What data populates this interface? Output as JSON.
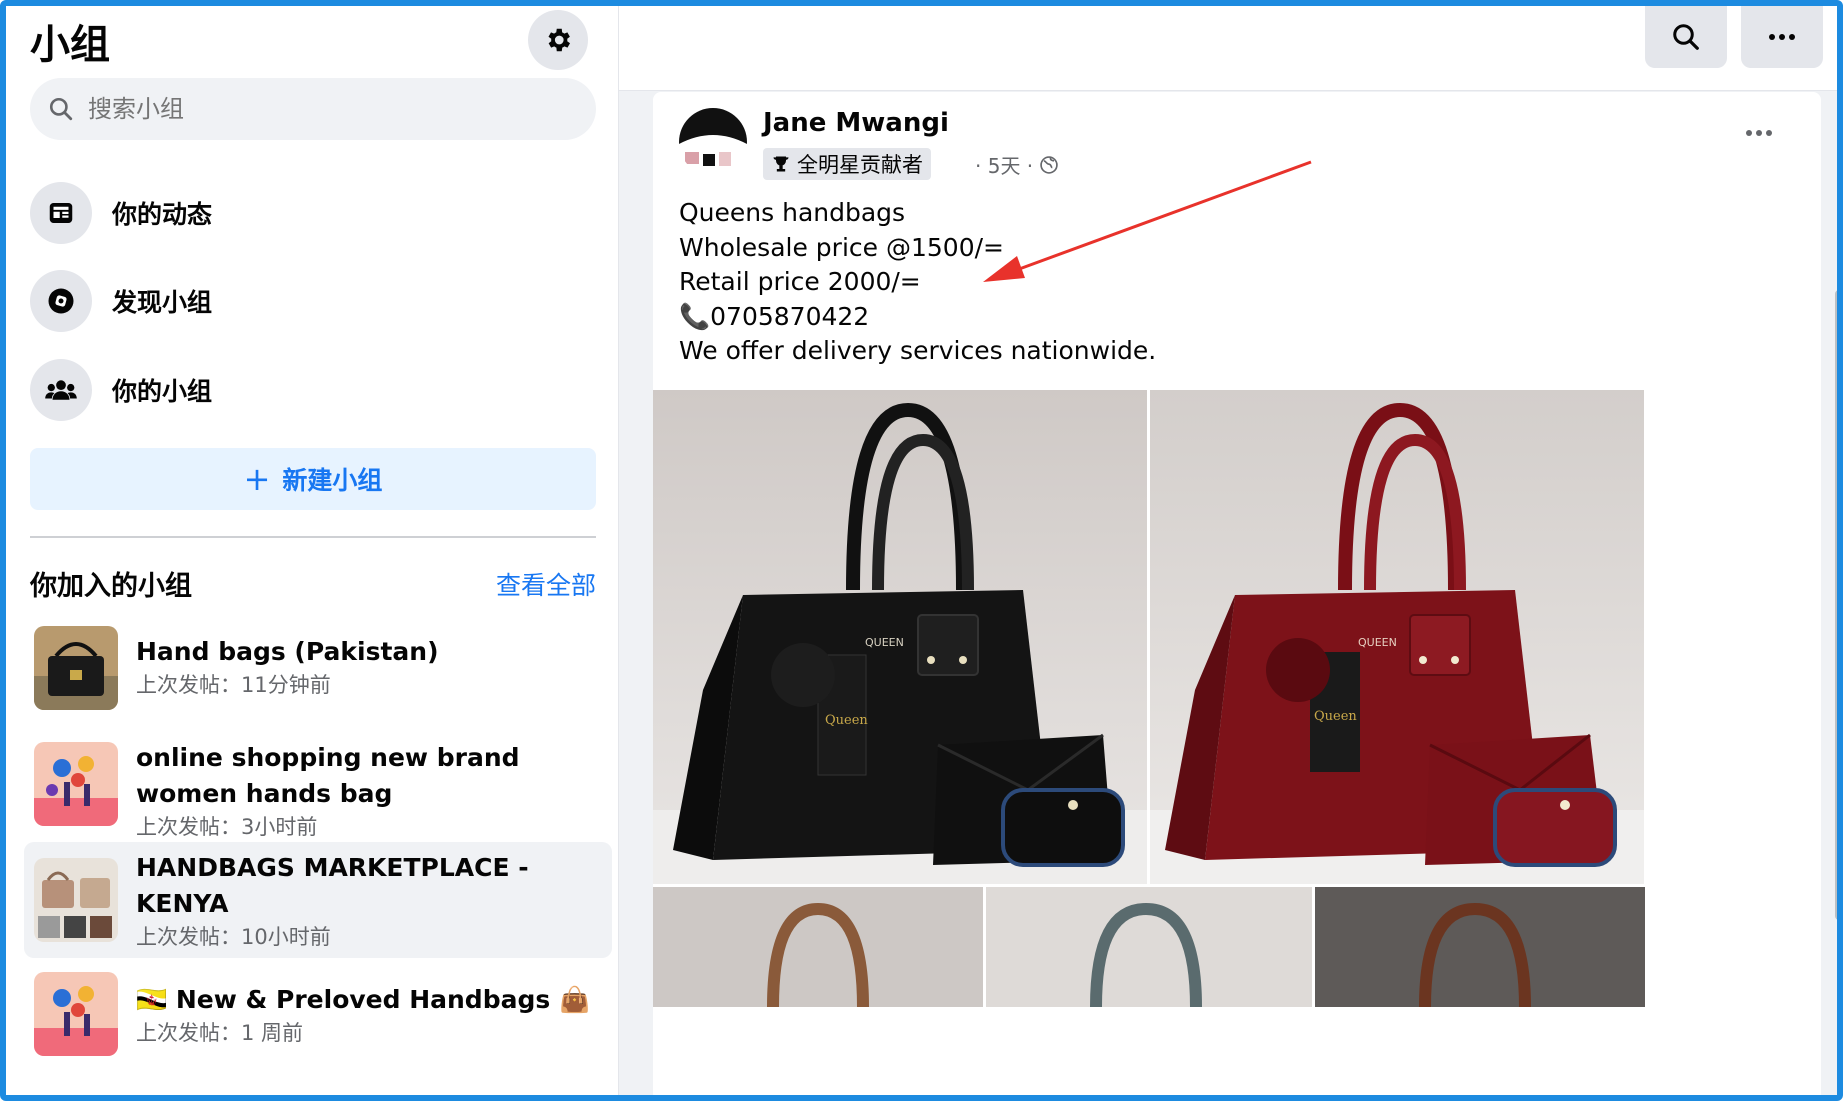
{
  "sidebar": {
    "title": "小组",
    "search_placeholder": "搜索小组",
    "nav": [
      {
        "label": "你的动态",
        "icon": "feed-icon"
      },
      {
        "label": "发现小组",
        "icon": "compass-icon"
      },
      {
        "label": "你的小组",
        "icon": "people-icon"
      }
    ],
    "new_group_label": "新建小组",
    "joined_title": "你加入的小组",
    "see_all": "查看全部",
    "groups": [
      {
        "name": "Hand bags (Pakistan)",
        "meta": "上次发帖：11分钟前"
      },
      {
        "name": "online shopping new brand women hands bag",
        "meta": "上次发帖：3小时前"
      },
      {
        "name": "HANDBAGS MARKETPLACE - KENYA",
        "meta": "上次发帖：10小时前"
      },
      {
        "name": "🇧🇳 New & Preloved Handbags 👜",
        "meta": "上次发帖：1 周前"
      }
    ]
  },
  "post": {
    "author": "Jane Mwangi",
    "badge": "全明星贡献者",
    "time": "· 5天 ·",
    "lines": [
      "Queens handbags",
      "Wholesale price @1500/=",
      "Retail price 2000/=",
      "📞0705870422",
      "We offer delivery services nationwide."
    ]
  },
  "colors": {
    "accent": "#1877f2",
    "frame": "#1d8be0",
    "annotation_arrow": "#e8322b"
  }
}
